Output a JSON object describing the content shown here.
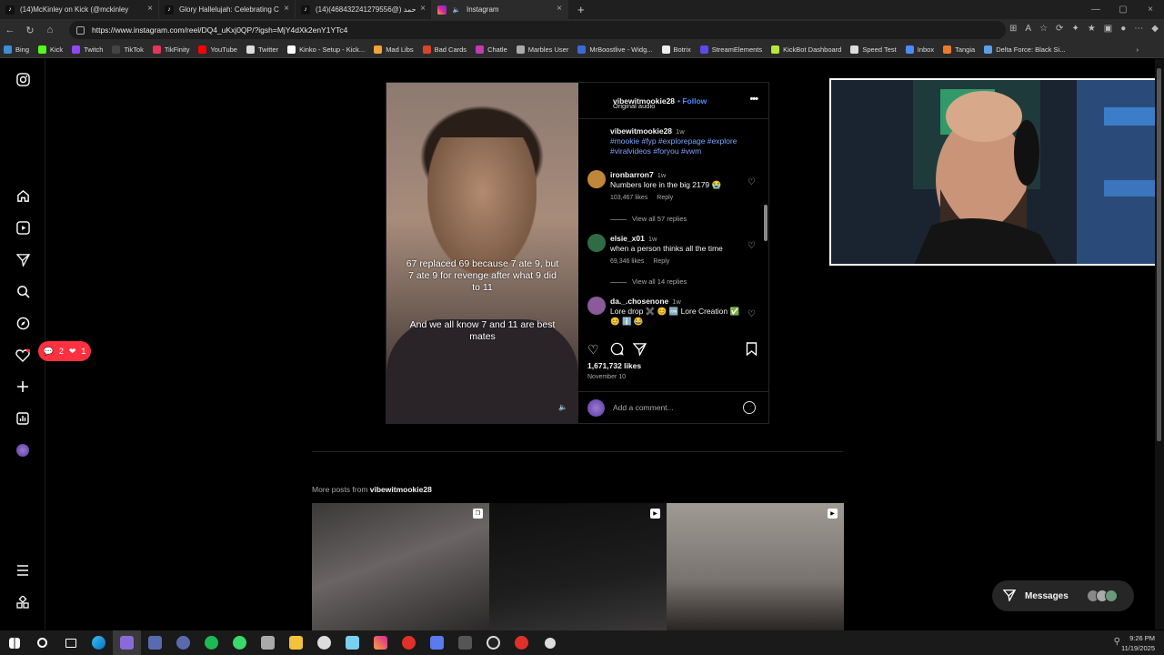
{
  "browser": {
    "tabs": [
      {
        "label": "(14)McKinley on Kick (@mckinley",
        "icon": "tiktok-icon",
        "active": false
      },
      {
        "label": "Glory Hallelujah: Celebrating Can",
        "icon": "tiktok-icon",
        "active": false
      },
      {
        "label": "(14)راد احمد (@468432241279556)",
        "icon": "tiktok-icon",
        "active": false
      },
      {
        "label": "Instagram",
        "icon": "instagram-icon",
        "active": true
      }
    ],
    "new_tab": "+",
    "url": "https://www.instagram.com/reel/DQ4_uKxj0QP/?igsh=MjY4dXk2enY1YTc4",
    "bookmarks": [
      {
        "label": "Bing",
        "color": "#3b8fd8"
      },
      {
        "label": "Kick",
        "color": "#53fc18"
      },
      {
        "label": "Twitch",
        "color": "#9146ff"
      },
      {
        "label": "TikTok",
        "color": "#111111"
      },
      {
        "label": "TikFinity",
        "color": "#e8345a"
      },
      {
        "label": "YouTube",
        "color": "#ff0000"
      },
      {
        "label": "Twitter",
        "color": "#dddddd"
      },
      {
        "label": "Kinko - Setup - Kick...",
        "color": "#ffffff"
      },
      {
        "label": "Mad Libs",
        "color": "#f2a33a"
      },
      {
        "label": "Bad Cards",
        "color": "#d9452b"
      },
      {
        "label": "Chatle",
        "color": "#c23ab4"
      },
      {
        "label": "Marbles User",
        "color": "#aaaaaa"
      },
      {
        "label": "MrBoostlive - Widg...",
        "color": "#3a6ad9"
      },
      {
        "label": "Botrix",
        "color": "#eeeeee"
      },
      {
        "label": "StreamElements",
        "color": "#5a4af0"
      },
      {
        "label": "KickBot Dashboard",
        "color": "#b5e83a"
      },
      {
        "label": "Speed Test",
        "color": "#dddddd"
      },
      {
        "label": "Inbox",
        "color": "#4a8bff"
      },
      {
        "label": "Tangia",
        "color": "#f07a2a"
      },
      {
        "label": "Delta Force: Black Si...",
        "color": "#5aa0e8"
      }
    ]
  },
  "sidebar": {
    "notif_comments": "2",
    "notif_likes": "1"
  },
  "post": {
    "username": "vibewitmookie28",
    "follow": "• Follow",
    "audio": "Original audio",
    "caption_user": "vibewitmookie28",
    "caption_time": "1w",
    "caption_tags": "#mookie #fyp #explorepage #explore #viralvideos #foryou #vwm",
    "video_text_1": "67 replaced 69 because 7 ate 9, but 7 ate 9 for revenge after what 9 did to 11",
    "video_text_2": "And we all know 7 and 11 are best mates",
    "comments": [
      {
        "user": "ironbarron7",
        "time": "1w",
        "text": "Numbers lore in the big 2179 😭",
        "likes": "103,467 likes",
        "reply": "Reply",
        "avatar": "#c0863a",
        "view_replies": "View all 57 replies"
      },
      {
        "user": "elsie_x01",
        "time": "1w",
        "text": "when a person thinks all the time",
        "likes": "69,346 likes",
        "reply": "Reply",
        "avatar": "#2f6b45",
        "view_replies": "View all 14 replies"
      },
      {
        "user": "da._.chosenone",
        "time": "1w",
        "text": "Lore drop ✖️ 😊 🆒 Lore Creation ✅ 😊 ℹ️ 😂",
        "likes": "",
        "reply": "",
        "avatar": "#8a5a9a",
        "view_replies": ""
      }
    ],
    "like_count": "1,671,732 likes",
    "date": "November 10",
    "comment_placeholder": "Add a comment..."
  },
  "more_posts": {
    "prefix": "More posts from ",
    "user": "vibewitmookie28"
  },
  "messages": {
    "label": "Messages"
  },
  "taskbar": {
    "time": "9:26 PM",
    "date": "11/19/2025"
  }
}
